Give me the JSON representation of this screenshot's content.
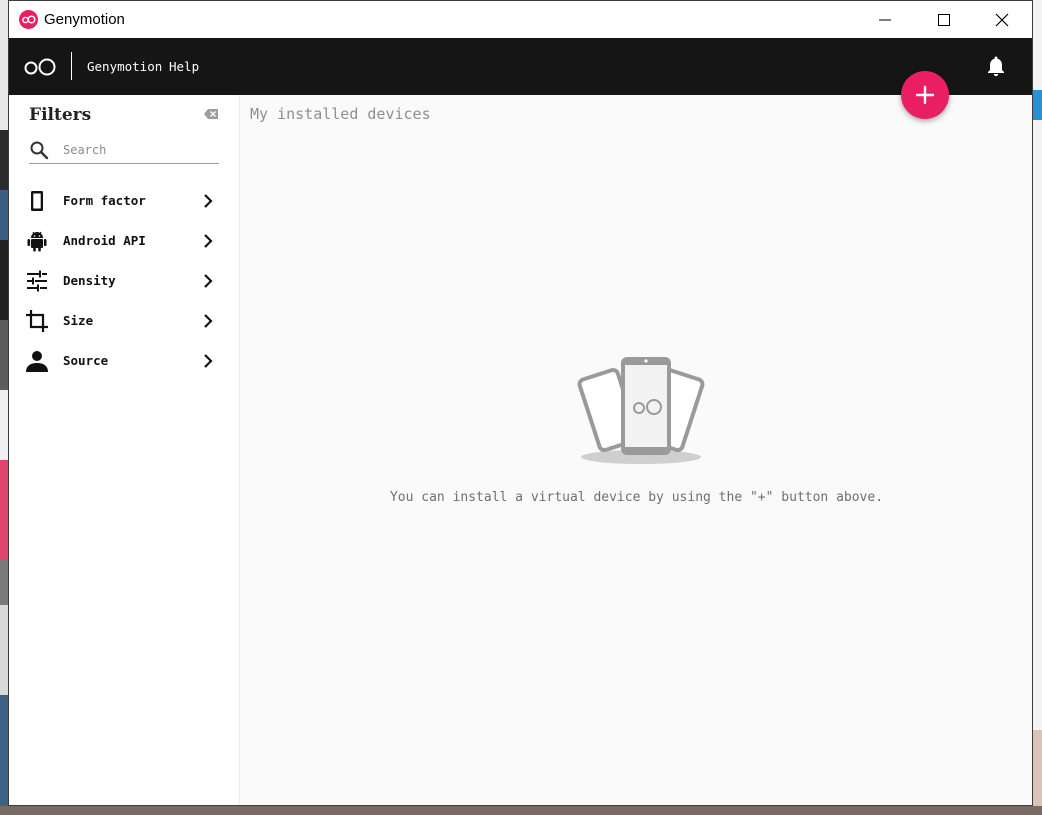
{
  "window": {
    "title": "Genymotion"
  },
  "appbar": {
    "menu": [
      "Genymotion",
      "Help"
    ]
  },
  "sidebar": {
    "title": "Filters",
    "search": {
      "placeholder": "Search",
      "value": ""
    },
    "items": [
      {
        "label": "Form factor",
        "icon": "phone-icon"
      },
      {
        "label": "Android API",
        "icon": "android-icon"
      },
      {
        "label": "Density",
        "icon": "tune-icon"
      },
      {
        "label": "Size",
        "icon": "crop-icon"
      },
      {
        "label": "Source",
        "icon": "person-icon"
      }
    ]
  },
  "main": {
    "title": "My installed devices",
    "empty_message": "You can install a virtual device by using the \"+\" button above."
  },
  "colors": {
    "accent": "#e91e63",
    "appbar": "#151515",
    "background": "#fafafa"
  }
}
